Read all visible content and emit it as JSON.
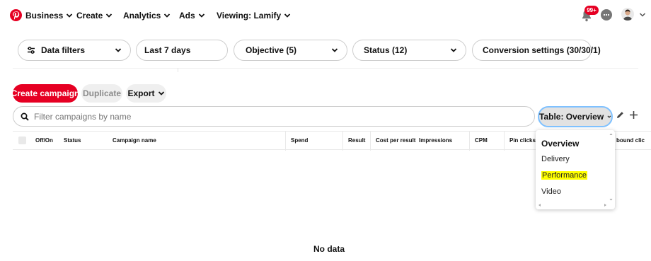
{
  "nav": {
    "items": [
      {
        "label": "Business"
      },
      {
        "label": "Create"
      },
      {
        "label": "Analytics"
      },
      {
        "label": "Ads"
      },
      {
        "label": "Viewing: Lamify"
      }
    ],
    "notification_count": "99+"
  },
  "filters": {
    "data_filters": "Data filters",
    "date_range": "Last 7 days",
    "objective": "Objective (5)",
    "status": "Status (12)",
    "conversion": "Conversion settings (30/30/1)"
  },
  "actions": {
    "create": "Create campaign",
    "duplicate": "Duplicate",
    "export": "Export"
  },
  "search": {
    "placeholder": "Filter campaigns by name"
  },
  "table_view": {
    "label": "Table: Overview",
    "options": [
      "Overview",
      "Delivery",
      "Performance",
      "Video"
    ],
    "selected": "Overview",
    "highlighted": "Performance"
  },
  "table": {
    "columns": [
      "Off/On",
      "Status",
      "Campaign name",
      "Spend",
      "Result",
      "Cost per result",
      "Impressions",
      "CPM",
      "Pin clicks (",
      "bound clic"
    ],
    "empty_text": "No data"
  },
  "colors": {
    "brand": "#e60023",
    "highlight": "#ffff00",
    "focus": "#7fc1ff"
  }
}
